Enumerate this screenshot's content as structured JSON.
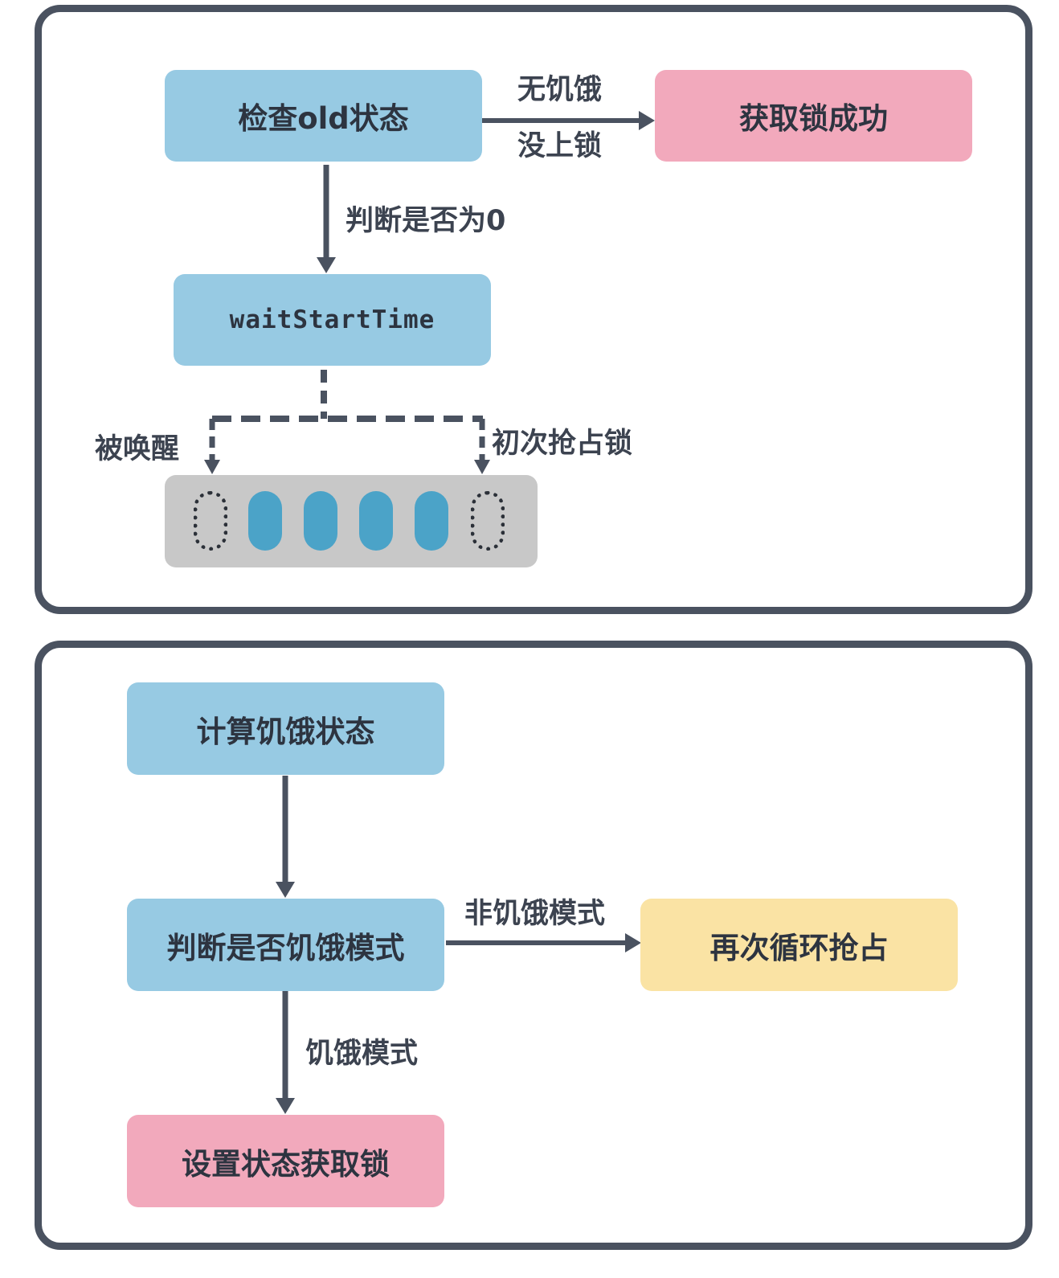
{
  "top_panel": {
    "check_old_state": "检查old状态",
    "acquire_lock_success": "获取锁成功",
    "not_starving_label": "无饥饿",
    "not_locked_label": "没上锁",
    "check_zero_label": "判断是否为0",
    "wait_start_time": "waitStartTime",
    "woken_label": "被唤醒",
    "first_grab_label": "初次抢占锁",
    "queue": {
      "slots": [
        "empty",
        "filled",
        "filled",
        "filled",
        "filled",
        "empty"
      ]
    }
  },
  "bottom_panel": {
    "compute_starving": "计算饥饿状态",
    "check_starving_mode": "判断是否饥饿模式",
    "non_starving_label": "非饥饿模式",
    "retry_grab": "再次循环抢占",
    "starving_label": "饥饿模式",
    "set_state_acquire": "设置状态获取锁"
  },
  "colors": {
    "border": "#4a5260",
    "arrow": "#4a5260",
    "node_blue": "#97cae3",
    "node_pink": "#f2a9bc",
    "node_yellow": "#fae3a4",
    "queue_bg": "#c8c8c8",
    "slot_filled": "#4ba3c8"
  }
}
